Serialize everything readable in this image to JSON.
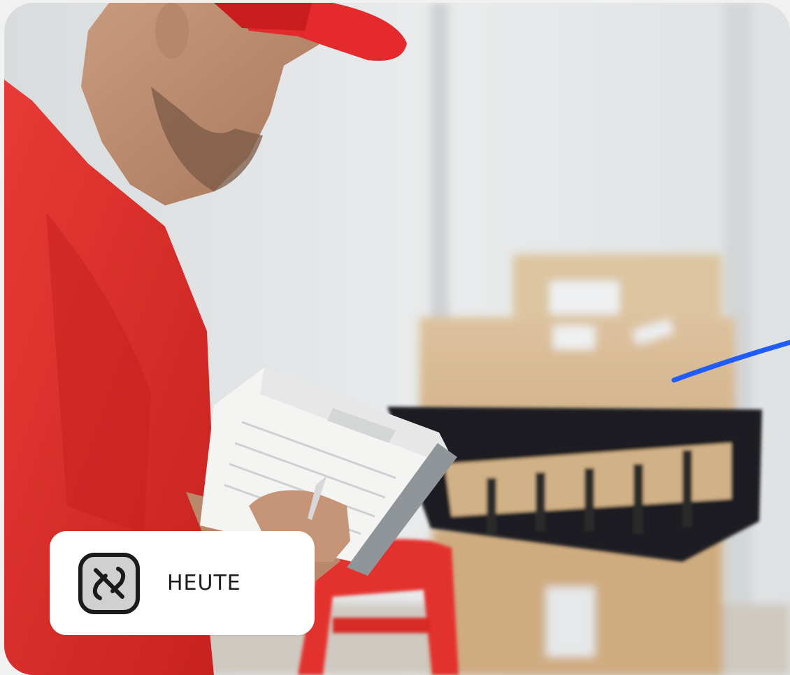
{
  "badge": {
    "label": "HEUTE",
    "icon": "unlinked-icon"
  },
  "colors": {
    "shirt_red": "#e0312f",
    "accent_line": "#1f5bff",
    "badge_bg": "#ffffff",
    "cardboard": "#d7b88f"
  }
}
